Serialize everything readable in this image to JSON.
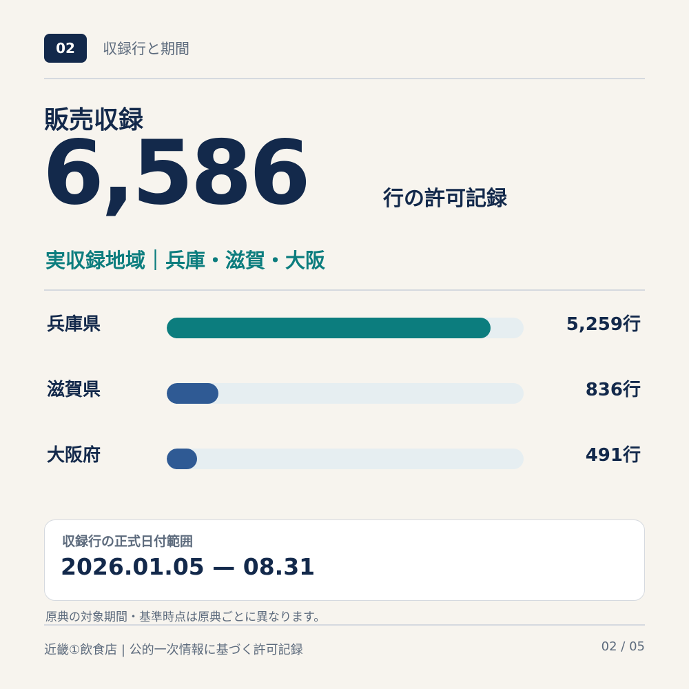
{
  "header": {
    "badge": "02",
    "section_title": "収録行と期間"
  },
  "main": {
    "headline": "販売収録",
    "big_number": "6,586",
    "unit_label": "行の許可記録",
    "region_line": "実収録地域｜兵庫・滋賀・大阪"
  },
  "chart_data": {
    "type": "bar",
    "orientation": "horizontal",
    "categories": [
      "兵庫県",
      "滋賀県",
      "大阪府"
    ],
    "values": [
      5259,
      836,
      491
    ],
    "value_labels": [
      "5,259行",
      "836行",
      "491行"
    ],
    "xlim": [
      0,
      5800
    ],
    "colors": [
      "#0c7d7e",
      "#2f5a94",
      "#2f5a94"
    ],
    "track_color": "#e6eef1"
  },
  "date_card": {
    "label": "収録行の正式日付範囲",
    "value": "2026.01.05 — 08.31"
  },
  "note": "原典の対象期間・基準時点は原典ごとに異なります。",
  "footer": {
    "left": "近畿①飲食店 | 公的一次情報に基づく許可記録",
    "page": "02 / 05"
  }
}
